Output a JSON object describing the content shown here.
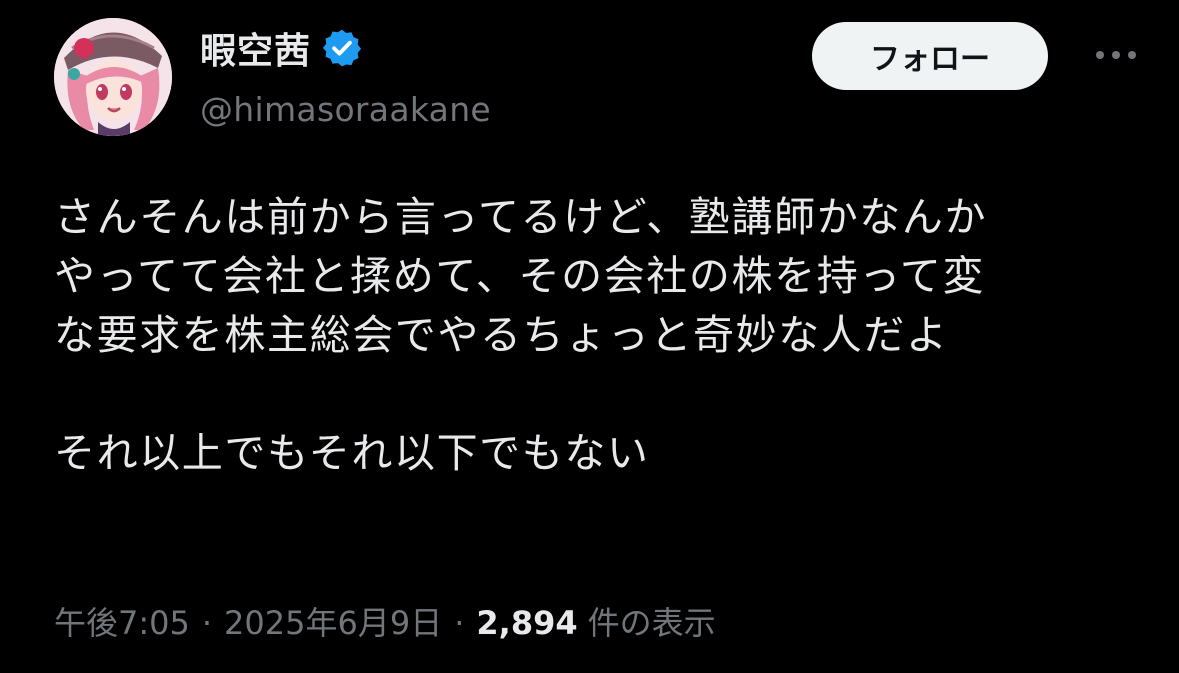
{
  "author": {
    "display_name": "暇空茜",
    "handle": "@himasoraakane",
    "verified": true,
    "verified_badge_color": "#1d9bf0",
    "avatar_icon": "anime-avatar-icon"
  },
  "actions": {
    "follow_label": "フォロー",
    "more_icon": "more-options-icon"
  },
  "tweet": {
    "lines": [
      "さんそんは前から言ってるけど、塾講師かなんか",
      "やってて会社と揉めて、その会社の株を持って変",
      "な要求を株主総会でやるちょっと奇妙な人だよ",
      "",
      "それ以上でもそれ以下でもない"
    ]
  },
  "meta": {
    "time": "午後7:05",
    "separator": "·",
    "date": "2025年6月9日",
    "views_count": "2,894",
    "views_label": "件の表示"
  },
  "colors": {
    "background": "#000000",
    "text_primary": "#e7e9ea",
    "text_secondary": "#71767b",
    "follow_bg": "#eff3f4",
    "follow_text": "#0f1419"
  }
}
